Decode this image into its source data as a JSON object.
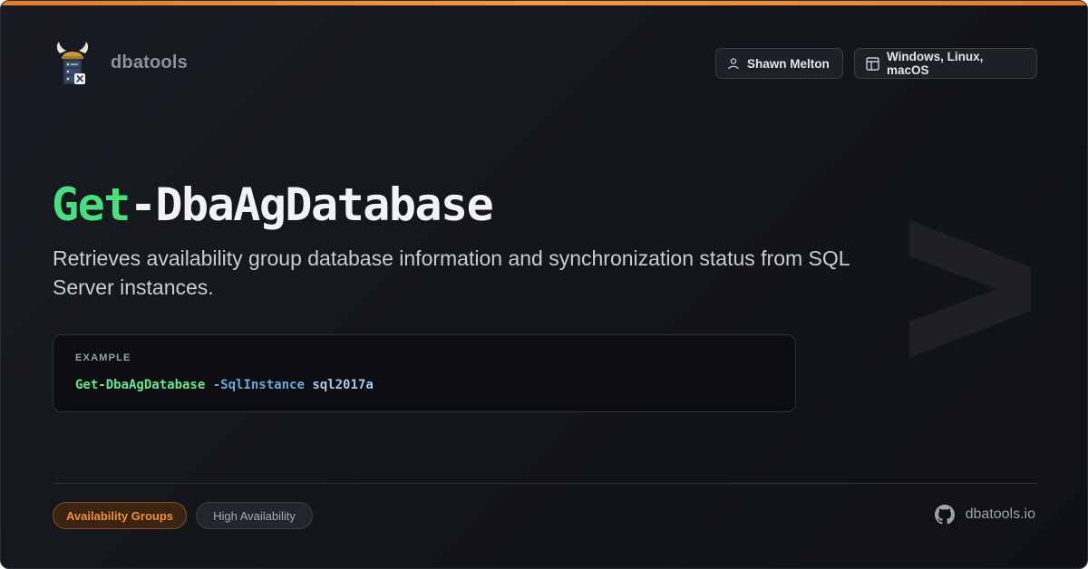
{
  "brand": {
    "name": "dbatools",
    "logo_icon": "viking-server-icon"
  },
  "header": {
    "author": {
      "label": "Shawn Melton",
      "icon": "user-icon"
    },
    "platforms": {
      "label": "Windows, Linux, macOS",
      "icon": "window-layout-icon"
    }
  },
  "command": {
    "verb": "Get",
    "noun": "-DbaAgDatabase",
    "description": "Retrieves availability group database information and synchronization status from SQL Server instances."
  },
  "example": {
    "label": "EXAMPLE",
    "command": "Get-DbaAgDatabase",
    "parameter": "-SqlInstance",
    "value": "sql2017a"
  },
  "tags": {
    "primary": "Availability Groups",
    "secondary": "High Availability"
  },
  "footer": {
    "site": "dbatools.io",
    "site_icon": "github-icon"
  },
  "colors": {
    "accent": "#f29a45",
    "verb": "#4ade80",
    "background": "#121519"
  }
}
